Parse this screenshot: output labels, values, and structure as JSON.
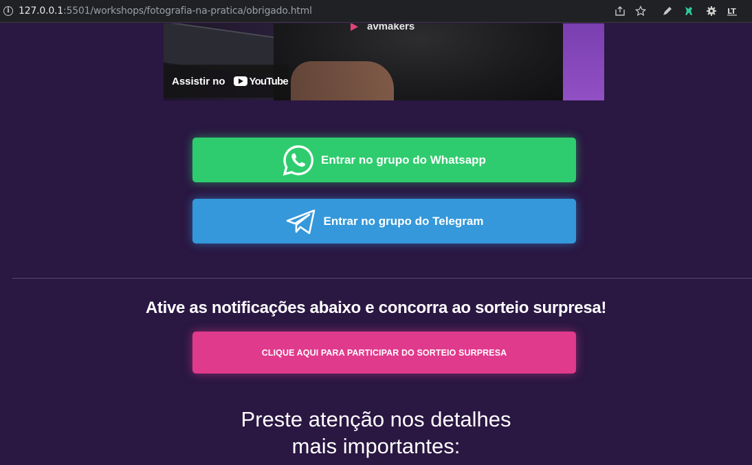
{
  "browser": {
    "url_host": "127.0.0.1",
    "url_rest": ":5501/workshops/fotografia-na-pratica/obrigado.html",
    "icons": [
      "info-icon",
      "share-icon",
      "star-icon",
      "pen-icon",
      "extension-icon",
      "gear-icon",
      "translate-icon"
    ]
  },
  "video": {
    "brand": "avmakers",
    "watch_label": "Assistir no",
    "youtube_label": "YouTube"
  },
  "buttons": {
    "whatsapp": "Entrar no grupo do Whatsapp",
    "telegram": "Entrar no grupo do Telegram",
    "raffle": "CLIQUE AQUI PARA PARTICIPAR DO SORTEIO SURPRESA"
  },
  "headline": "Ative as notificações abaixo e concorra ao sorteio surpresa!",
  "subhead": {
    "line1": "Preste atenção nos detalhes",
    "line2": "mais importantes:"
  },
  "colors": {
    "background": "#2a1742",
    "whatsapp": "#2ecc6e",
    "telegram": "#3498db",
    "raffle": "#e03a8c"
  }
}
